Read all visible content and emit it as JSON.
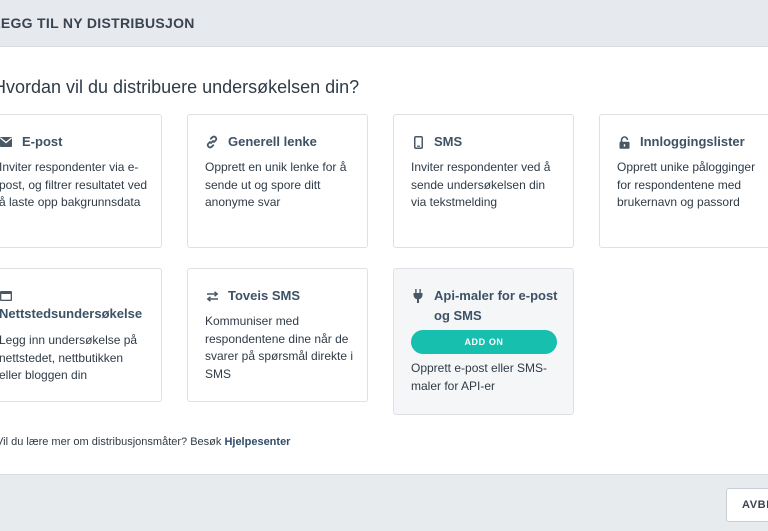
{
  "header": {
    "title": "LEGG TIL NY DISTRIBUSJON"
  },
  "question": "Hvordan vil du distribuere undersøkelsen din?",
  "cards": [
    {
      "title": "E-post",
      "icon": "envelope-icon",
      "description": "Inviter respondenter via e-post, og filtrer resultatet ved å laste opp bakgrunnsdata"
    },
    {
      "title": "Generell lenke",
      "icon": "link-icon",
      "description": "Opprett en unik lenke for å sende ut og spore ditt anonyme svar"
    },
    {
      "title": "SMS",
      "icon": "mobile-phone-icon",
      "description": "Inviter respondenter ved å sende undersøkelsen din via tekstmelding"
    },
    {
      "title": "Innloggingslister",
      "icon": "lock-icon",
      "description": "Opprett unike pålogginger for respondentene med brukernavn og passord"
    },
    {
      "title": "Nettstedsundersøkelse",
      "icon": "browser-window-icon",
      "description": "Legg inn undersøkelse på nettstedet, nettbutikken eller bloggen din"
    },
    {
      "title": "Toveis SMS",
      "icon": "two-way-arrows-icon",
      "description": "Kommuniser med respondentene dine når de svarer på spørsmål direkte i SMS"
    },
    {
      "title": "Api-maler for e-post og SMS",
      "icon": "plug-icon",
      "badge": "ADD ON",
      "description": "Opprett e-post eller SMS-maler for API-er"
    }
  ],
  "help": {
    "text": "Vil du lære mer om distribusjonsmåter? Besøk ",
    "link": "Hjelpesenter"
  },
  "footer": {
    "cancel_label": "AVBRYT"
  },
  "colors": {
    "accent": "#17bfae",
    "header_bg": "#e6e9ed",
    "footer_bg": "#e8ebee",
    "title_text": "#3d5266"
  }
}
